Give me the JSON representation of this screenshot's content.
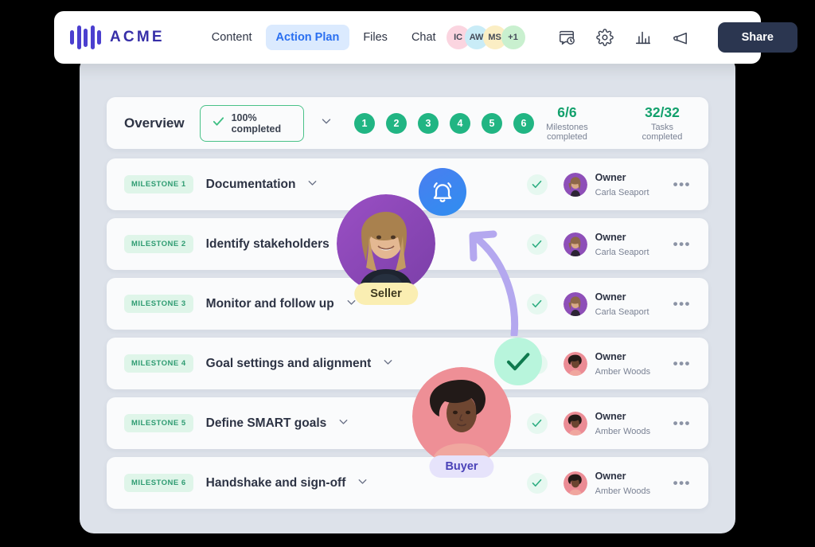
{
  "brand": {
    "name": "ACME",
    "logo_icon": "acme-bars-logo",
    "color": "#372fa8"
  },
  "nav": {
    "items": [
      {
        "label": "Content",
        "active": false
      },
      {
        "label": "Action Plan",
        "active": true
      },
      {
        "label": "Files",
        "active": false
      },
      {
        "label": "Chat",
        "active": false
      }
    ],
    "active_color": "#2a6ff0",
    "active_bg": "#dbeafe"
  },
  "collaborators": [
    {
      "initials": "IC",
      "color": "#fbd5e0"
    },
    {
      "initials": "AW",
      "color": "#c9ecf7"
    },
    {
      "initials": "MS",
      "color": "#fbeec4"
    },
    {
      "initials": "+1",
      "color": "#c9f0cf"
    }
  ],
  "toolbar_icons": [
    {
      "name": "activity-history-icon"
    },
    {
      "name": "gear-icon"
    },
    {
      "name": "bar-chart-icon"
    },
    {
      "name": "megaphone-icon"
    }
  ],
  "share": {
    "label": "Share",
    "bg": "#2b3650"
  },
  "overview": {
    "title": "Overview",
    "completion_badge": {
      "label": "100% completed",
      "icon": "check-icon",
      "border": "#49c288"
    },
    "chevron_icon": "chevron-down-icon",
    "steps": [
      "1",
      "2",
      "3",
      "4",
      "5",
      "6"
    ],
    "step_color": "#21b583",
    "stats": [
      {
        "value": "6/6",
        "caption": "Milestones completed"
      },
      {
        "value": "32/32",
        "caption": "Tasks completed"
      }
    ]
  },
  "milestones": [
    {
      "badge": "MILESTONE 1",
      "title": "Documentation",
      "status_icon": "check-icon",
      "owner_role": "Owner",
      "owner_name": "Carla Seaport",
      "avatar": "carla",
      "menu_icon": "more-horizontal-icon"
    },
    {
      "badge": "MILESTONE 2",
      "title": "Identify stakeholders",
      "status_icon": "check-icon",
      "owner_role": "Owner",
      "owner_name": "Carla Seaport",
      "avatar": "carla",
      "menu_icon": "more-horizontal-icon"
    },
    {
      "badge": "MILESTONE 3",
      "title": "Monitor and follow up",
      "status_icon": "check-icon",
      "owner_role": "Owner",
      "owner_name": "Carla Seaport",
      "avatar": "carla",
      "menu_icon": "more-horizontal-icon"
    },
    {
      "badge": "MILESTONE 4",
      "title": "Goal settings and alignment",
      "status_icon": "check-icon",
      "owner_role": "Owner",
      "owner_name": "Amber Woods",
      "avatar": "amber",
      "menu_icon": "more-horizontal-icon"
    },
    {
      "badge": "MILESTONE 5",
      "title": "Define SMART goals",
      "status_icon": "check-icon",
      "owner_role": "Owner",
      "owner_name": "Amber Woods",
      "avatar": "amber",
      "menu_icon": "more-horizontal-icon"
    },
    {
      "badge": "MILESTONE 6",
      "title": "Handshake and sign-off",
      "status_icon": "check-icon",
      "owner_role": "Owner",
      "owner_name": "Amber Woods",
      "avatar": "amber",
      "menu_icon": "more-horizontal-icon"
    }
  ],
  "personas": {
    "seller": {
      "label": "Seller",
      "badge_icon": "bell-icon",
      "badge_bg": "#f5c518",
      "pill_bg": "#faeeb2"
    },
    "buyer": {
      "label": "Buyer",
      "badge_icon": "check-icon",
      "badge_bg": "#b8f5dc",
      "pill_bg": "#e6e3fb"
    }
  },
  "annotation": {
    "arrow_icon": "curved-arrow-icon",
    "color": "#b4a8ef"
  }
}
